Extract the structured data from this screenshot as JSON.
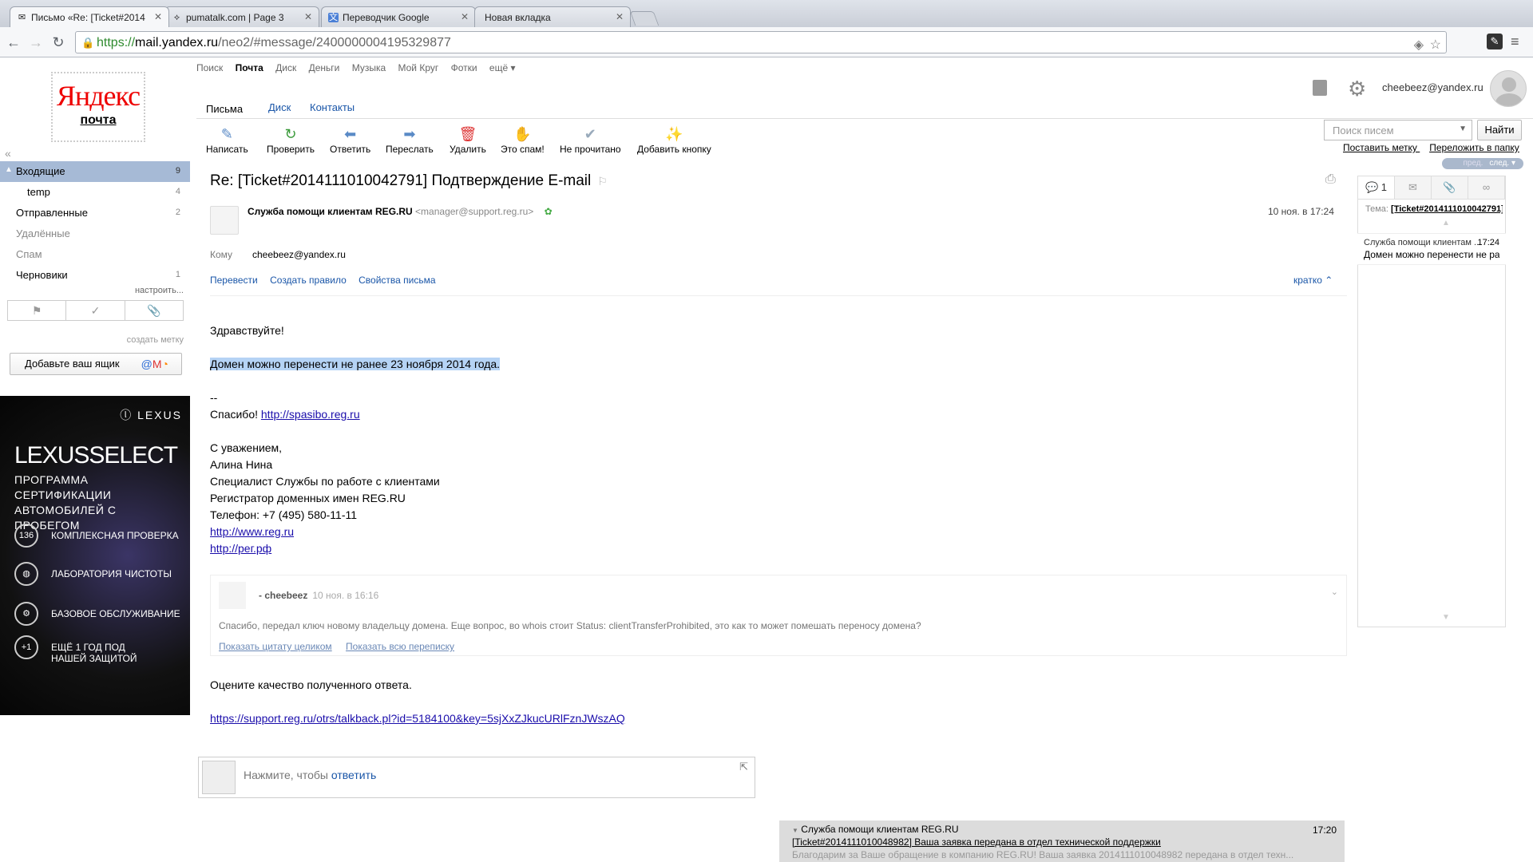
{
  "browser": {
    "tabs": [
      {
        "title": "Письмо «Re: [Ticket#2014",
        "favicon": "mail-icon"
      },
      {
        "title": "pumatalk.com | Page 3",
        "favicon": "link-icon"
      },
      {
        "title": "Переводчик Google",
        "favicon": "translate-icon"
      },
      {
        "title": "Новая вкладка",
        "favicon": ""
      }
    ],
    "url_scheme": "https://",
    "url_host": "mail.yandex.ru",
    "url_path": "/neo2/#message/2400000004195329877"
  },
  "services": [
    "Поиск",
    "Почта",
    "Диск",
    "Деньги",
    "Музыка",
    "Мой Круг",
    "Фотки",
    "ещё ▾"
  ],
  "logo": {
    "yandex": "Яндекс",
    "mail": "почта"
  },
  "user": {
    "email": "cheebeez@yandex.ru"
  },
  "section_tabs": [
    "Письма",
    "Диск",
    "Контакты"
  ],
  "actions": [
    {
      "label": "Написать",
      "icon": "✎",
      "color": "#5a8ac6"
    },
    {
      "label": "Проверить",
      "icon": "↻",
      "color": "#3a9a3a"
    },
    {
      "label": "Ответить",
      "icon": "⬅",
      "color": "#5a8ac6"
    },
    {
      "label": "Переслать",
      "icon": "➡",
      "color": "#5a8ac6"
    },
    {
      "label": "Удалить",
      "icon": "🗑",
      "color": "#d33"
    },
    {
      "label": "Это спам!",
      "icon": "✋",
      "color": "#f0a000"
    },
    {
      "label": "Не прочитано",
      "icon": "✔",
      "color": "#9ab"
    },
    {
      "label": "Добавить кнопку",
      "icon": "✨",
      "color": "#d33"
    }
  ],
  "search": {
    "placeholder": "Поиск писем",
    "button": "Найти",
    "link_label": "Поставить метку",
    "link_move": "Переложить в папку"
  },
  "pager": {
    "prev": "пред.",
    "next": "след. ▾"
  },
  "folders": [
    {
      "name": "Входящие",
      "count": "9",
      "active": true
    },
    {
      "name": "temp",
      "count": "4",
      "sub": true
    },
    {
      "name": "Отправленные",
      "count": "2"
    },
    {
      "name": "Удалённые",
      "count": "",
      "dim": true
    },
    {
      "name": "Спам",
      "count": "",
      "dim": true
    },
    {
      "name": "Черновики",
      "count": "1"
    }
  ],
  "sidebar": {
    "configure": "настроить...",
    "create_label": "создать метку",
    "add_box": "Добавьте ваш ящик"
  },
  "ad": {
    "brand": "ⓛ LEXUS",
    "title": "LEXUSSELECT",
    "subtitle": "ПРОГРАММА СЕРТИФИКАЦИИ АВТОМОБИЛЕЙ С ПРОБЕГОМ",
    "items": [
      {
        "badge": "136",
        "text": "КОМПЛЕКСНАЯ ПРОВЕРКА"
      },
      {
        "badge": "◍",
        "text": "ЛАБОРАТОРИЯ ЧИСТОТЫ"
      },
      {
        "badge": "⚙",
        "text": "БАЗОВОЕ ОБСЛУЖИВАНИЕ"
      },
      {
        "badge": "+1",
        "text": "ЕЩЁ 1 ГОД ПОД НАШЕЙ ЗАЩИТОЙ"
      }
    ]
  },
  "message": {
    "subject": "Re: [Ticket#2014111010042791] Подтверждение E-mail",
    "sender_name": "Служба помощи клиентам REG.RU",
    "sender_addr": "<manager@support.reg.ru>",
    "date": "10 ноя. в 17:24",
    "to_label": "Кому",
    "to_value": "cheebeez@yandex.ru",
    "links": [
      "Перевести",
      "Создать правило",
      "Свойства письма"
    ],
    "brief": "кратко ⌃",
    "greeting": "Здравствуйте!",
    "highlight": "Домен можно перенести не ранее 23 ноября 2014 года.",
    "dash": "--",
    "thanks": "Спасибо!",
    "thanks_link": "http://spasibo.reg.ru",
    "sig": [
      "С уважением,",
      "Алина Нина",
      "Специалист Службы по работе с клиентами",
      "Регистратор доменных имен REG.RU",
      "Телефон: +7 (495) 580-11-11"
    ],
    "sig_links": [
      "http://www.reg.ru",
      "http://рег.рф"
    ],
    "quote_name": "- cheebeez",
    "quote_date": "10 ноя. в 16:16",
    "quote_text": "Спасибо, передал ключ новому владельцу домена. Еще вопрос, во whois стоит Status: clientTransferProhibited, это как то может помешать переносу домена?",
    "quote_show": "Показать цитату целиком",
    "quote_all": "Показать всю переписку",
    "rate": "Оцените качество полученного ответа.",
    "rate_link": "https://support.reg.ru/otrs/talkback.pl?id=5184100&key=5sjXxZJkucURlFznJWszAQ"
  },
  "reply": {
    "prefix": "Нажмите, чтобы ",
    "action": "ответить"
  },
  "thread": {
    "count": "1",
    "subject_label": "Тема:",
    "subject": "[Ticket#2014111010042791]",
    "item_name": "Служба помощи клиентам ...",
    "item_time": "17:24",
    "item_text": "Домен можно перенести не ра..."
  },
  "notification": {
    "from": "Служба помощи клиентам REG.RU",
    "time": "17:20",
    "subject": "[Ticket#2014111010048982] Ваша заявка передана в отдел технической поддержки",
    "body": "Благодарим за Ваше обращение в компанию REG.RU! Ваша заявка 2014111010048982 передана в отдел техн..."
  }
}
